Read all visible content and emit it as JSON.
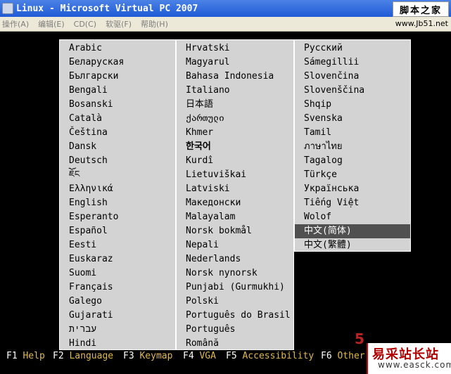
{
  "window": {
    "title": "Linux - Microsoft Virtual PC 2007",
    "watermark_title": "脚本之家",
    "watermark_url": "www.Jb51.net"
  },
  "menu": [
    "操作(A)",
    "编辑(E)",
    "CD(C)",
    "软驱(F)",
    "帮助(H)"
  ],
  "columns": [
    [
      "Arabic",
      "Беларуская",
      "Български",
      "Bengali",
      "Bosanski",
      "Català",
      "Čeština",
      "Dansk",
      "Deutsch",
      "ཇོང",
      "Ελληνικά",
      "English",
      "Esperanto",
      "Español",
      "Eesti",
      "Euskaraz",
      "Suomi",
      "Français",
      "Galego",
      "Gujarati",
      "עברית",
      "Hindi"
    ],
    [
      "Hrvatski",
      "Magyarul",
      "Bahasa Indonesia",
      "Italiano",
      "日本語",
      "ქართული",
      "Khmer",
      "한국어",
      "Kurdî",
      "Lietuviškai",
      "Latviski",
      "Македонски",
      "Malayalam",
      "Norsk bokmål",
      "Nepali",
      "Nederlands",
      "Norsk nynorsk",
      "Punjabi (Gurmukhi)",
      "Polski",
      "Português do Brasil",
      "Português",
      "Română"
    ],
    [
      "Русский",
      "Sámegillii",
      "Slovenčina",
      "Slovenščina",
      "Shqip",
      "Svenska",
      "Tamil",
      "ภาษาไทย",
      "Tagalog",
      "Türkçe",
      "Українська",
      "Tiếng Việt",
      "Wolof",
      "中文(简体)",
      "中文(繁體)"
    ]
  ],
  "selected": {
    "column": 2,
    "index": 13
  },
  "footer": [
    {
      "key": "F1",
      "label": "Help"
    },
    {
      "key": "F2",
      "label": "Language"
    },
    {
      "key": "F3",
      "label": "Keymap"
    },
    {
      "key": "F4",
      "label": "VGA"
    },
    {
      "key": "F5",
      "label": "Accessibility"
    },
    {
      "key": "F6",
      "label": "Other"
    }
  ],
  "logo": {
    "text": "易采站长站",
    "url": "www.easck.com"
  },
  "colors": {
    "menu_bg": "#d3d3d3",
    "selected_bg": "#505050",
    "footer_label": "#e2b94c",
    "titlebar": "#2a63d8"
  }
}
